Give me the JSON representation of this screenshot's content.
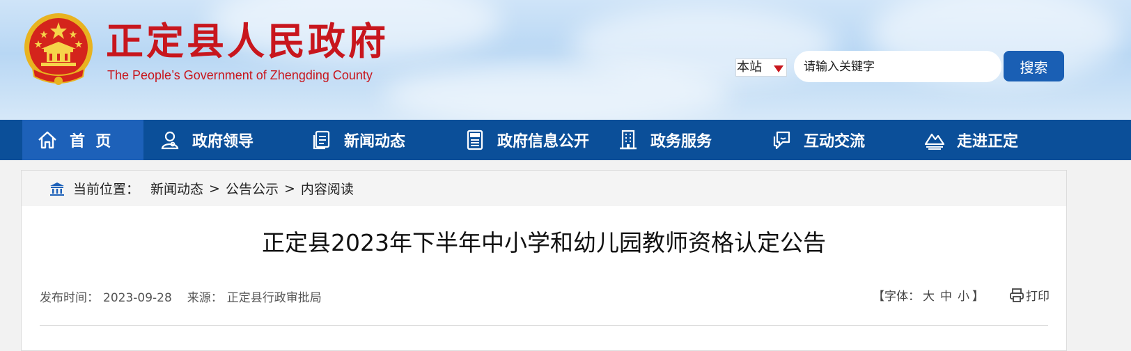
{
  "header": {
    "title": "正定县人民政府",
    "subtitle": "The People’s Government  of  Zhengding County",
    "search": {
      "scope": "本站",
      "placeholder": "请输入关键字",
      "button_label": "搜索"
    }
  },
  "colors": {
    "brand_red": "#c8161d",
    "nav_blue": "#0b4f99",
    "nav_active_blue": "#1d61b9",
    "button_blue": "#1a5fb4"
  },
  "nav": {
    "items": [
      {
        "label": "首  页",
        "icon": "home-icon",
        "active": true
      },
      {
        "label": "政府领导",
        "icon": "user-icon",
        "active": false
      },
      {
        "label": "新闻动态",
        "icon": "document-stack-icon",
        "active": false
      },
      {
        "label": "政府信息公开",
        "icon": "newspaper-icon",
        "active": false
      },
      {
        "label": "政务服务",
        "icon": "building-icon",
        "active": false
      },
      {
        "label": "互动交流",
        "icon": "chat-icon",
        "active": false
      },
      {
        "label": "走进正定",
        "icon": "landscape-icon",
        "active": false
      }
    ]
  },
  "breadcrumb": {
    "icon": "government-building-icon",
    "label": "当前位置：",
    "items": [
      "新闻动态",
      "公告公示",
      "内容阅读"
    ],
    "separator": ">"
  },
  "article": {
    "title": "正定县2023年下半年中小学和幼儿园教师资格认定公告",
    "publish_label": "发布时间：",
    "publish_date": "2023-09-28",
    "source_label": "来源：",
    "source": "正定县行政审批局",
    "font_label_open": "【字体：",
    "font_sizes": [
      "大",
      "中",
      "小"
    ],
    "font_label_close": "】",
    "print_label": "打印"
  }
}
